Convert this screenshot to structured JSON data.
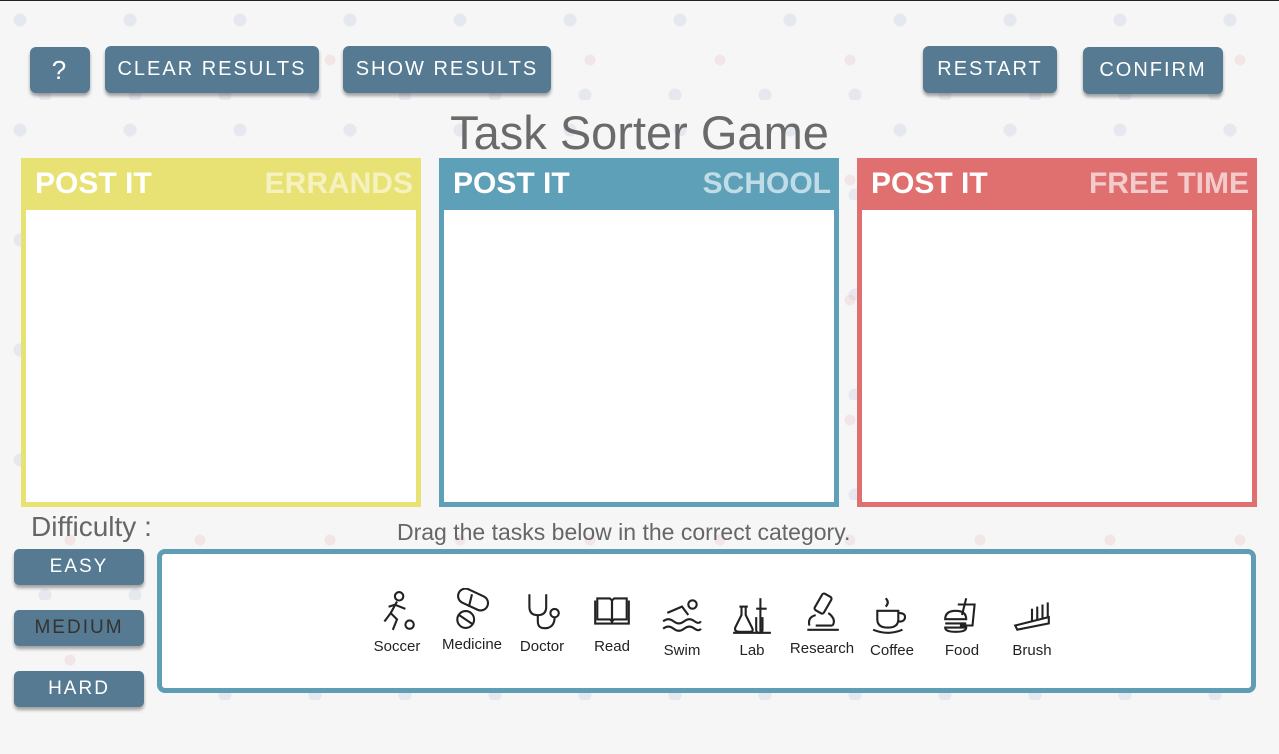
{
  "toolbar": {
    "help_label": "?",
    "clear_label": "CLEAR RESULTS",
    "show_label": "SHOW RESULTS",
    "restart_label": "RESTART",
    "confirm_label": "CONFIRM"
  },
  "title": "Task Sorter Game",
  "postits": [
    {
      "header": "POST IT",
      "category": "ERRANDS",
      "color": "#e8e174",
      "category_color": "#f6f3c4"
    },
    {
      "header": "POST IT",
      "category": "SCHOOL",
      "color": "#5fa0b9",
      "category_color": "#c6e0ea"
    },
    {
      "header": "POST IT",
      "category": "FREE TIME",
      "color": "#e07070",
      "category_color": "#f6d0d0"
    }
  ],
  "difficulty": {
    "label": "Difficulty :",
    "options": [
      "EASY",
      "MEDIUM",
      "HARD"
    ]
  },
  "hint": "Drag the tasks below in the correct category.",
  "tasks": [
    {
      "label": "Soccer",
      "icon": "soccer-player-icon"
    },
    {
      "label": "Medicine",
      "icon": "pill-icon"
    },
    {
      "label": "Doctor",
      "icon": "stethoscope-icon"
    },
    {
      "label": "Read",
      "icon": "book-icon"
    },
    {
      "label": "Swim",
      "icon": "swimmer-icon"
    },
    {
      "label": "Lab",
      "icon": "lab-flask-icon"
    },
    {
      "label": "Research",
      "icon": "microscope-icon"
    },
    {
      "label": "Coffee",
      "icon": "coffee-cup-icon"
    },
    {
      "label": "Food",
      "icon": "fast-food-icon"
    },
    {
      "label": "Brush",
      "icon": "toothbrush-icon"
    }
  ]
}
